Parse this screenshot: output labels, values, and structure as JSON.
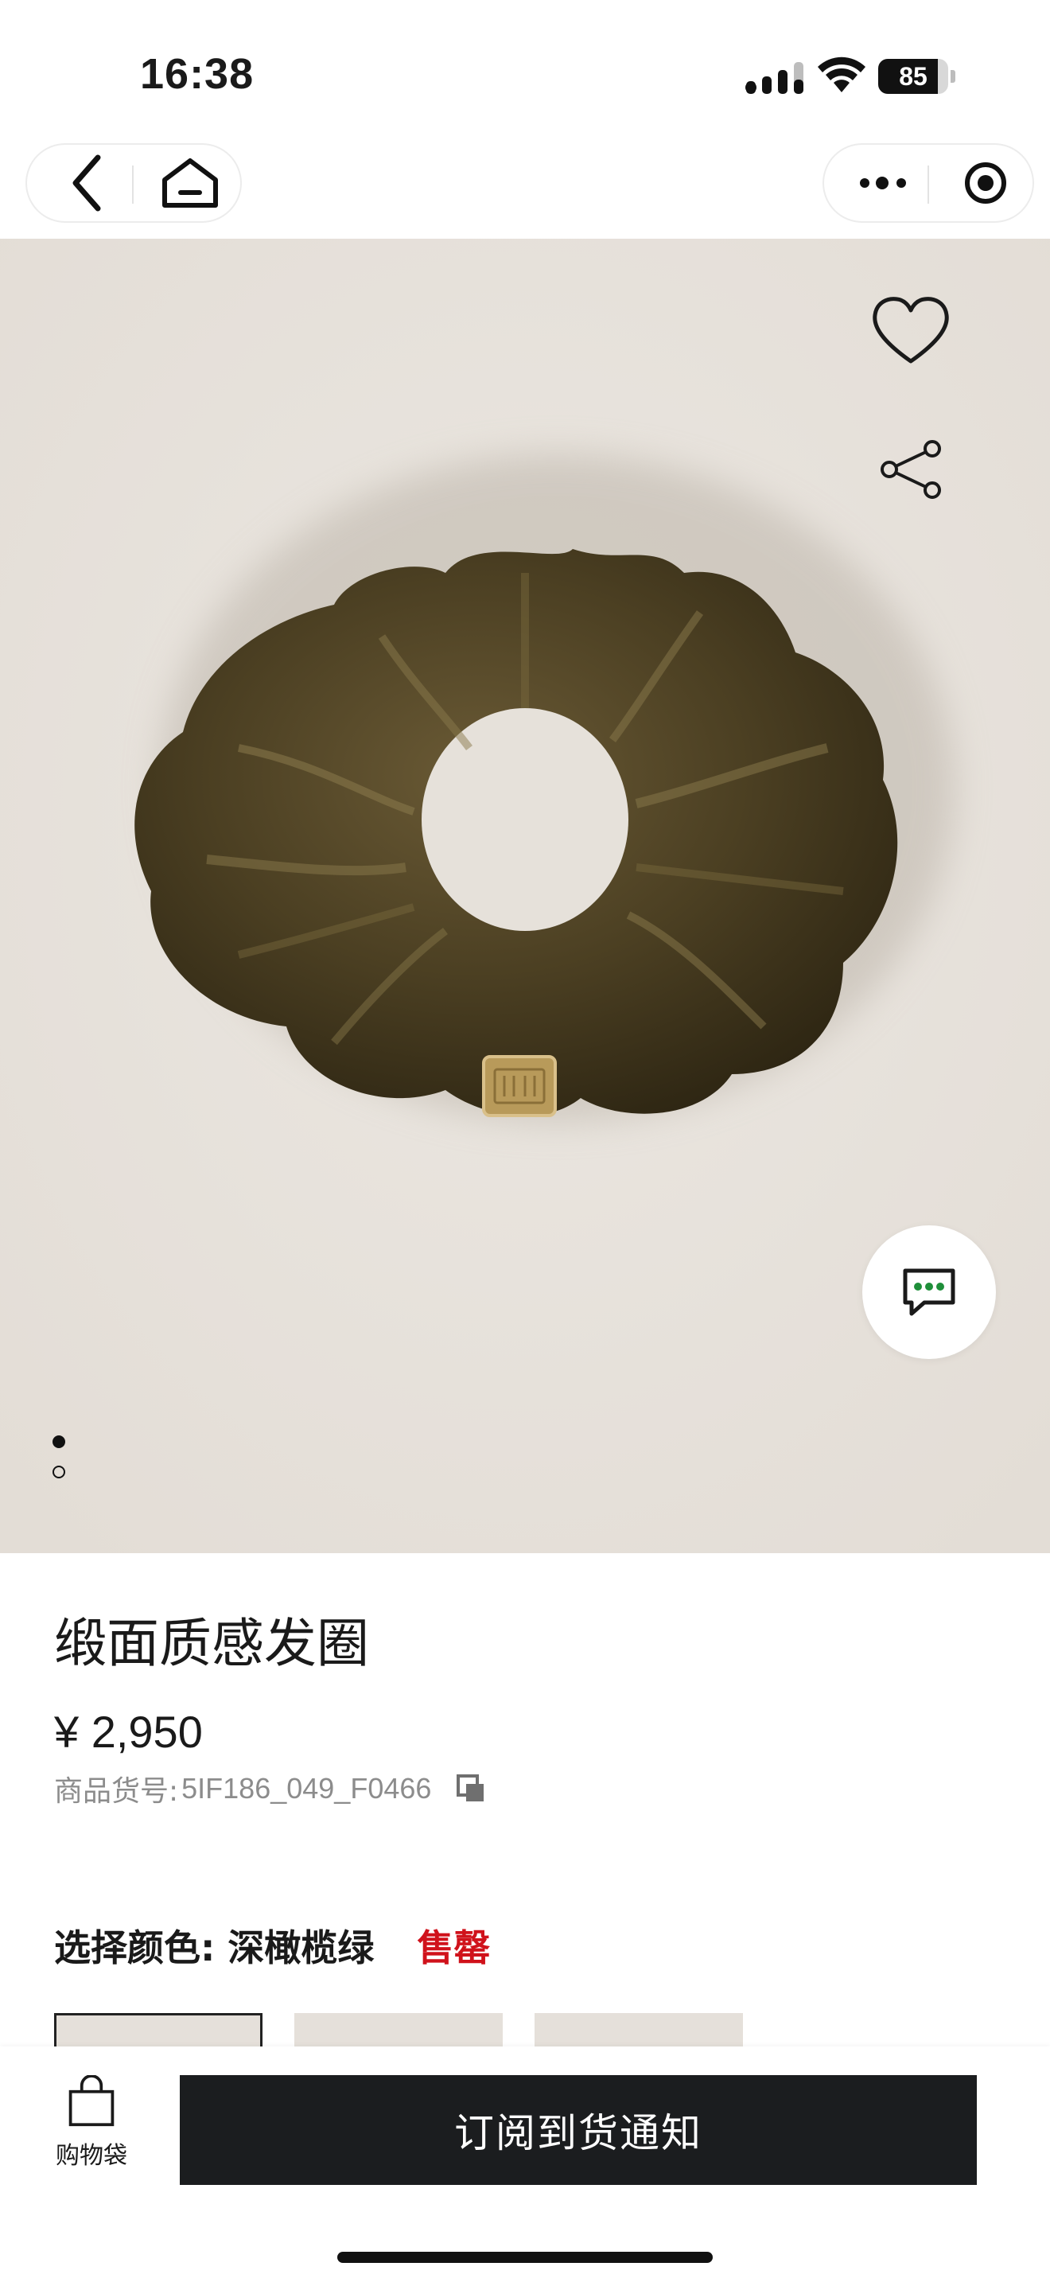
{
  "status_bar": {
    "time": "16:38",
    "battery_level": 85,
    "battery_label": "85"
  },
  "nav": {
    "back_icon": "chevron-left-icon",
    "home_icon": "home-icon",
    "more_icon": "more-dots-icon",
    "close_icon": "target-circle-icon"
  },
  "hero": {
    "image_desc_icon": "product-photo",
    "favorite_icon": "heart-icon",
    "share_icon": "share-icon",
    "chat_icon": "chat-bubble-icon",
    "carousel_total": 2,
    "carousel_active_index": 0
  },
  "product": {
    "name": "缎面质感发圈",
    "price": "¥ 2,950",
    "sku_label": "商品货号:",
    "sku_value": "5IF186_049_F0466"
  },
  "color_selector": {
    "label": "选择颜色: 深橄榄绿",
    "status": "售罄",
    "status_color": "#d0121b"
  },
  "bottom_bar": {
    "bag_label": "购物袋",
    "notify_button": "订阅到货通知"
  },
  "colors": {
    "hero_bg": "#e7e2dc",
    "button_bg": "#1b1d1f",
    "chat_dots": "#1f8f3a"
  }
}
